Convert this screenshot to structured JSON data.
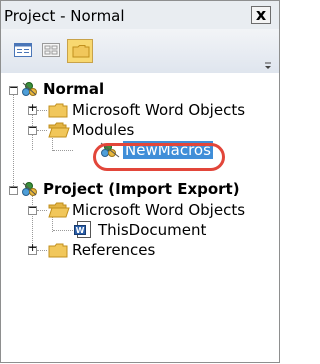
{
  "window": {
    "title": "Project - Normal",
    "close_glyph": "x"
  },
  "toolbar": {
    "buttons": [
      {
        "name": "view-code-icon"
      },
      {
        "name": "view-object-icon"
      },
      {
        "name": "toggle-folders-icon",
        "active": true
      }
    ]
  },
  "tree": {
    "normal": {
      "label": "Normal",
      "expander": "−"
    },
    "normal_word_objects": {
      "label": "Microsoft Word Objects",
      "expander": "+"
    },
    "modules": {
      "label": "Modules",
      "expander": "−"
    },
    "newmacros": {
      "label": "NewMacros",
      "selected": true
    },
    "project": {
      "label": "Project (Import Export)",
      "expander": "−"
    },
    "project_word_objects": {
      "label": "Microsoft Word Objects",
      "expander": "−"
    },
    "thisdocument": {
      "label": "ThisDocument"
    },
    "references": {
      "label": "References",
      "expander": "+"
    }
  },
  "colors": {
    "selection": "#3f8ed8",
    "highlight_ring": "#e2463a",
    "folder": "#f1c75b",
    "active_toolbar_button": "#f8d870"
  }
}
